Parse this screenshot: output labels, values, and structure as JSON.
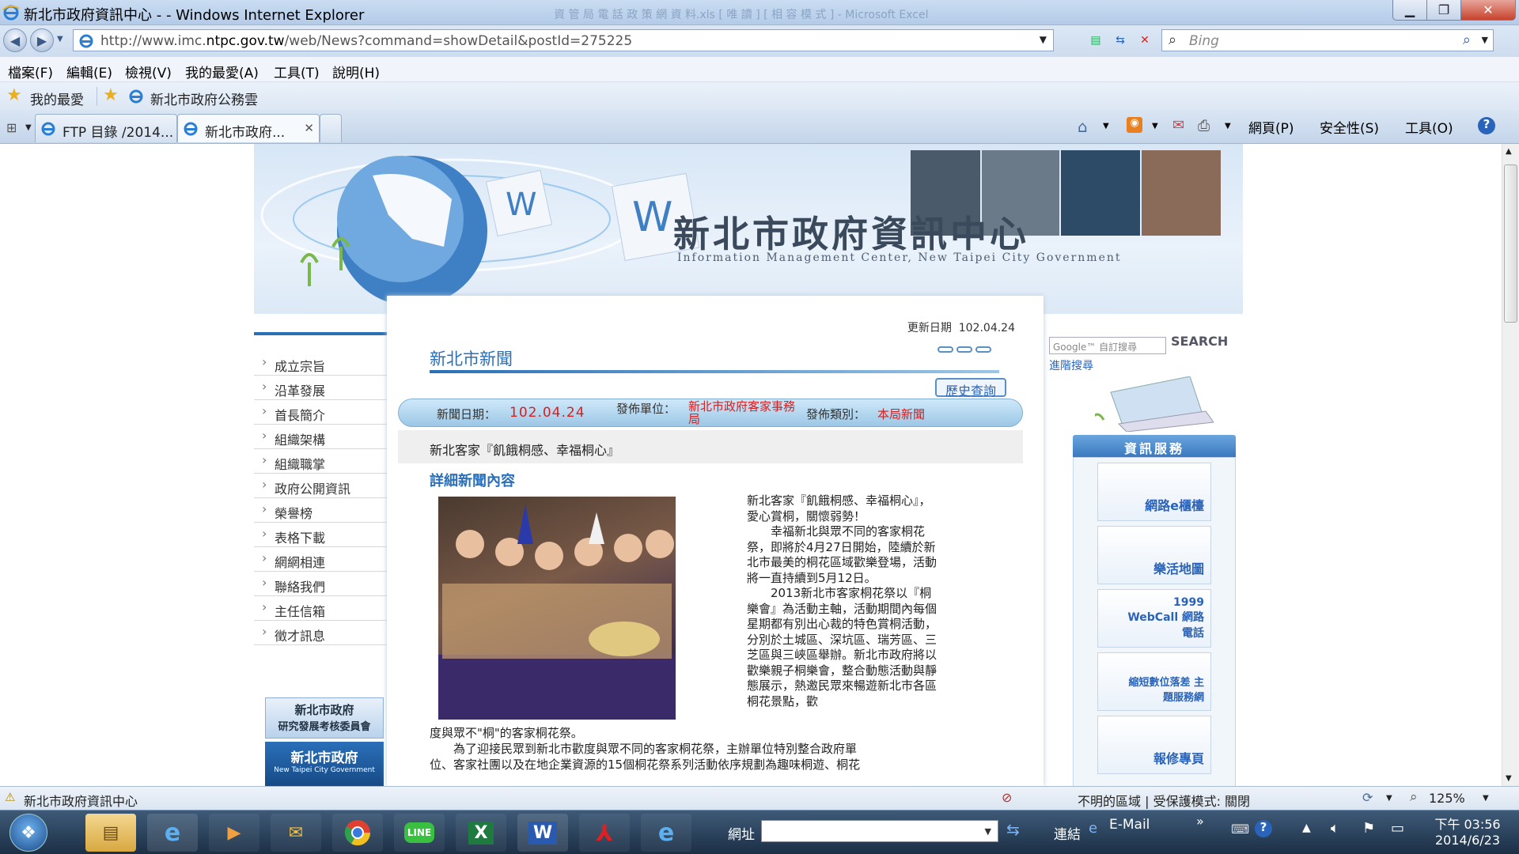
{
  "window": {
    "title": "新北市政府資訊中心 - - Windows Internet Explorer",
    "background_title": "資 管 局  電 話 政 策 網 資 料.xls  [ 唯 讀 ]  [ 相 容 模 式 ] - Microsoft Excel"
  },
  "addressbar": {
    "url_prefix": "http://www.imc.",
    "url_domain": "ntpc.gov.tw",
    "url_path": "/web/News?command=showDetail&postId=275225",
    "search_placeholder": "Bing"
  },
  "menu": [
    "檔案(F)",
    "編輯(E)",
    "檢視(V)",
    "我的最愛(A)",
    "工具(T)",
    "說明(H)"
  ],
  "favorites": {
    "label": "我的最愛",
    "link": "新北市政府公務雲"
  },
  "tabs": [
    {
      "label": "FTP 目錄 /2014..."
    },
    {
      "label": "新北市政府..."
    }
  ],
  "command_bar": [
    "網頁(P)",
    "安全性(S)",
    "工具(O)"
  ],
  "page": {
    "site_title": "新北市政府資訊中心",
    "site_subtitle": "Information Management Center, New Taipei City Government",
    "update_label": "更新日期",
    "update_date": "102.04.24",
    "section_title": "新北市新聞",
    "history_button": "歷史查詢",
    "news_date_label": "新聞日期：",
    "news_date": "102.04.24",
    "unit_label": "發佈單位：",
    "unit_value": "新北市政府客家事務局",
    "category_label": "發佈類別：",
    "category_value": "本局新聞",
    "headline": "新北客家『飢餓桐感、幸福桐心』",
    "detail_title": "詳細新聞內容",
    "body_side": "新北客家『飢餓桐感、幸福桐心』，愛心賞桐，關懷弱勢！\n　　幸福新北與眾不同的客家桐花祭，即將於4月27日開始，陸續於新北市最美的桐花區域歡樂登場，活動將一直持續到5月12日。\n　　2013新北市客家桐花祭以『桐樂會』為活動主軸，活動期間內每個星期都有別出心裁的特色賞桐活動，分別於土城區、深坑區、瑞芳區、三芝區與三峽區舉辦。新北市政府將以歡樂親子桐樂會，整合動態活動與靜態展示，熱邀民眾來暢遊新北市各區桐花景點，歡",
    "body_full_1": "度與眾不\"桐\"的客家桐花祭。",
    "body_full_2": "　　為了迎接民眾到新北市歡度與眾不同的客家桐花祭，主辦單位特別整合政府單",
    "body_full_3": "位、客家社團以及在地企業資源的15個桐花祭系列活動依序規劃為趣味桐遊、桐花"
  },
  "left_menu": [
    "成立宗旨",
    "沿革發展",
    "首長簡介",
    "組織架構",
    "組織職掌",
    "政府公開資訊",
    "榮譽榜",
    "表格下載",
    "網網相連",
    "聯絡我們",
    "主任信箱",
    "徵才訊息"
  ],
  "left_banners": [
    {
      "line1": "新北市政府",
      "line2": "研究發展考核委員會"
    },
    {
      "line1": "新北市政府",
      "line2": "New Taipei City Government"
    }
  ],
  "right": {
    "google_label": "Google™ 自訂搜尋",
    "search_button": "SEARCH",
    "advanced": "進階搜尋",
    "services_title": "資訊服務",
    "services": [
      "網路e櫃檯",
      "樂活地圖",
      "1999 WebCall 網路電話",
      "縮短數位落差 主題服務網",
      "報修專頁"
    ]
  },
  "status": {
    "left": "新北市政府資訊中心",
    "zone": "不明的區域 | 受保護模式: 關閉",
    "zoom": "125%"
  },
  "taskbar": {
    "address_label": "網址",
    "links_label": "連結",
    "email_label": "E-Mail",
    "time": "下午 03:56",
    "date": "2014/6/23"
  }
}
